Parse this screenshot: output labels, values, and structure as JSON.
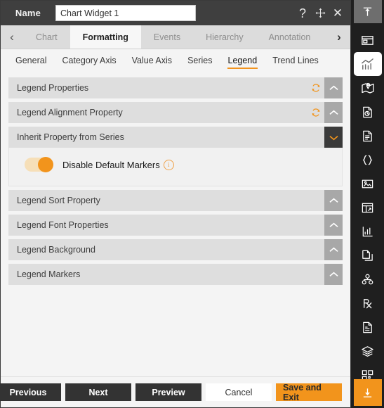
{
  "header": {
    "name_label": "Name",
    "name_value": "Chart Widget 1",
    "name_placeholder": "Chart Widget 1",
    "help_icon": "question-mark-icon",
    "move_icon": "move-icon",
    "close_icon": "close-icon"
  },
  "tabs": {
    "prev_arrow": "‹",
    "next_arrow": "›",
    "items": [
      {
        "label": "Chart",
        "active": false
      },
      {
        "label": "Formatting",
        "active": true
      },
      {
        "label": "Events",
        "active": false
      },
      {
        "label": "Hierarchy",
        "active": false
      },
      {
        "label": "Annotation",
        "active": false
      }
    ]
  },
  "subtabs": {
    "items": [
      {
        "label": "General",
        "active": false
      },
      {
        "label": "Category Axis",
        "active": false
      },
      {
        "label": "Value Axis",
        "active": false
      },
      {
        "label": "Series",
        "active": false
      },
      {
        "label": "Legend",
        "active": true
      },
      {
        "label": "Trend Lines",
        "active": false
      }
    ]
  },
  "sections": [
    {
      "title": "Legend Properties",
      "expanded": false,
      "has_reset": true
    },
    {
      "title": "Legend Alignment Property",
      "expanded": false,
      "has_reset": true
    },
    {
      "title": "Inherit Property from Series",
      "expanded": true,
      "has_reset": false
    },
    {
      "title": "Legend Sort Property",
      "expanded": false,
      "has_reset": false
    },
    {
      "title": "Legend Font Properties",
      "expanded": false,
      "has_reset": false
    },
    {
      "title": "Legend Background",
      "expanded": false,
      "has_reset": false
    },
    {
      "title": "Legend Markers",
      "expanded": false,
      "has_reset": false
    }
  ],
  "inherit_section": {
    "toggle_label": "Disable Default Markers",
    "toggle_on": true,
    "info_glyph": "i"
  },
  "footer": {
    "previous": "Previous",
    "next": "Next",
    "preview": "Preview",
    "cancel": "Cancel",
    "save_and_exit": "Save and Exit"
  },
  "rail": {
    "top_icon": "collapse-up-icon",
    "bottom_icon": "download-icon",
    "items": [
      {
        "icon": "widget-panel-icon",
        "active": false
      },
      {
        "icon": "chart-icon",
        "active": true
      },
      {
        "icon": "map-icon",
        "active": false
      },
      {
        "icon": "report-page-icon",
        "active": false
      },
      {
        "icon": "document-icon",
        "active": false
      },
      {
        "icon": "code-braces-icon",
        "active": false
      },
      {
        "icon": "image-icon",
        "active": false
      },
      {
        "icon": "table-icon",
        "active": false
      },
      {
        "icon": "bar-chart-icon",
        "active": false
      },
      {
        "icon": "copy-page-icon",
        "active": false
      },
      {
        "icon": "hierarchy-icon",
        "active": false
      },
      {
        "icon": "prescription-icon",
        "active": false
      },
      {
        "icon": "form-document-icon",
        "active": false
      },
      {
        "icon": "layers-icon",
        "active": false
      },
      {
        "icon": "grid-icon",
        "active": false
      }
    ]
  },
  "colors": {
    "accent": "#f2941c",
    "dark": "#333333",
    "rail_bg": "#1f1f1f",
    "header_bg": "#3f3f3f"
  }
}
